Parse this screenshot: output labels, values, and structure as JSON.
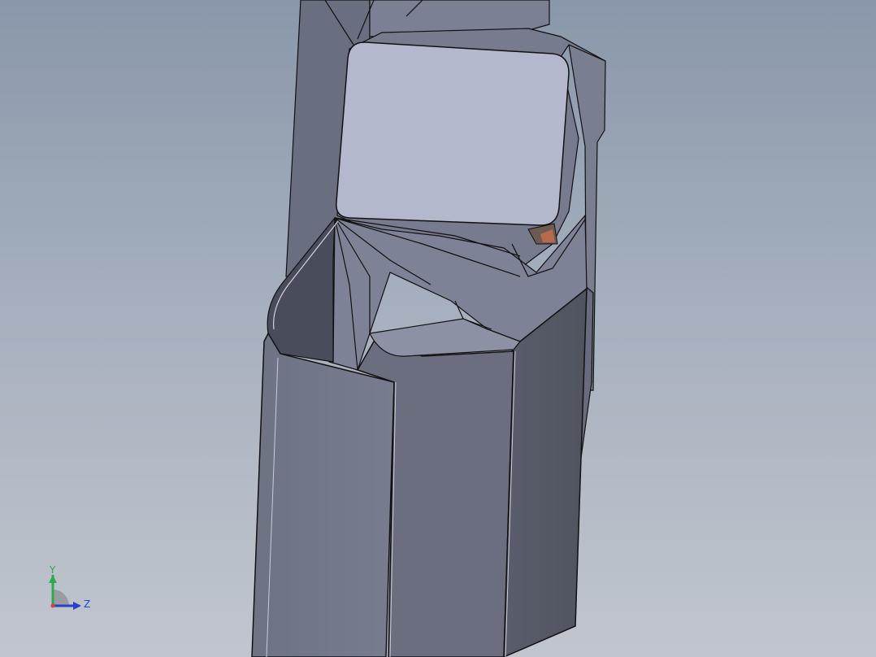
{
  "viewport": {
    "background_top": "#8a97aa",
    "background_bottom": "#c1c6ce"
  },
  "model": {
    "face_colors": {
      "light": "#b3b8cc",
      "mid": "#7a7f92",
      "dark": "#5a5e6e",
      "edge": "#111111"
    }
  },
  "triad": {
    "y_label": "Y",
    "z_label": "Z",
    "y_color": "#2fa84f",
    "z_color": "#2642c9"
  }
}
